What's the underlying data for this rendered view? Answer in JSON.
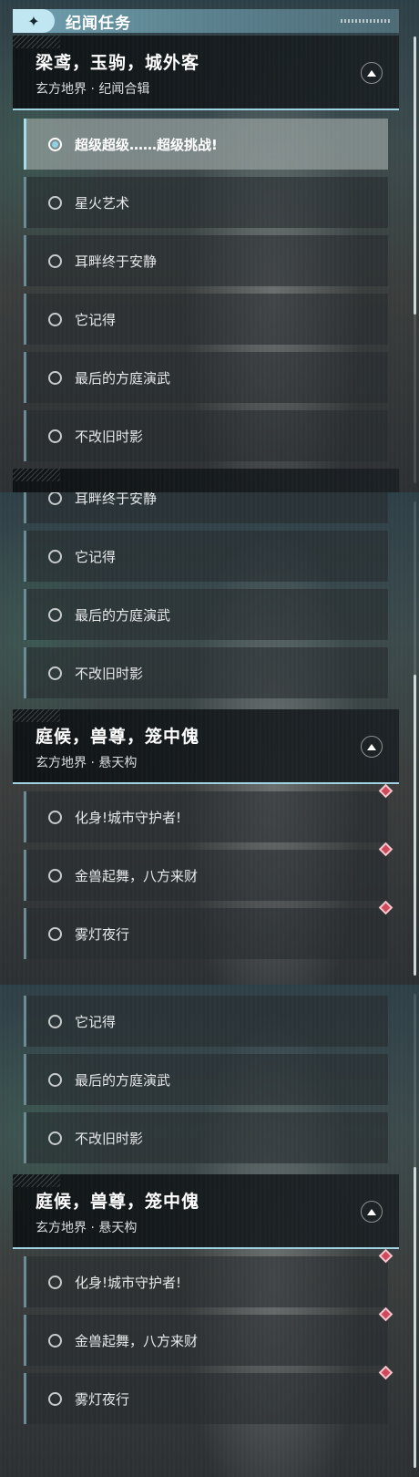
{
  "header": {
    "title": "纪闻任务",
    "icon": "sparkle-icon"
  },
  "colors": {
    "accent": "#9fd3e2",
    "header_bar": "#6f9fae",
    "badge": "#d0485b"
  },
  "groups": [
    {
      "title": "梁鸢，玉驹，城外客",
      "subtitle": "玄方地界 · 纪闻合辑",
      "quests": [
        {
          "label": "超级超级……超级挑战!",
          "selected": true
        },
        {
          "label": "星火艺术"
        },
        {
          "label": "耳畔终于安静"
        },
        {
          "label": "它记得"
        },
        {
          "label": "最后的方庭演武"
        },
        {
          "label": "不改旧时影"
        }
      ]
    },
    {
      "title": "庭候，兽尊，笼中傀",
      "subtitle": "玄方地界 · 悬天构",
      "quests": [
        {
          "label": "化身!城市守护者!",
          "badge": true
        },
        {
          "label": "金兽起舞，八方来财",
          "badge": true
        },
        {
          "label": "雾灯夜行",
          "badge": true
        }
      ]
    }
  ]
}
